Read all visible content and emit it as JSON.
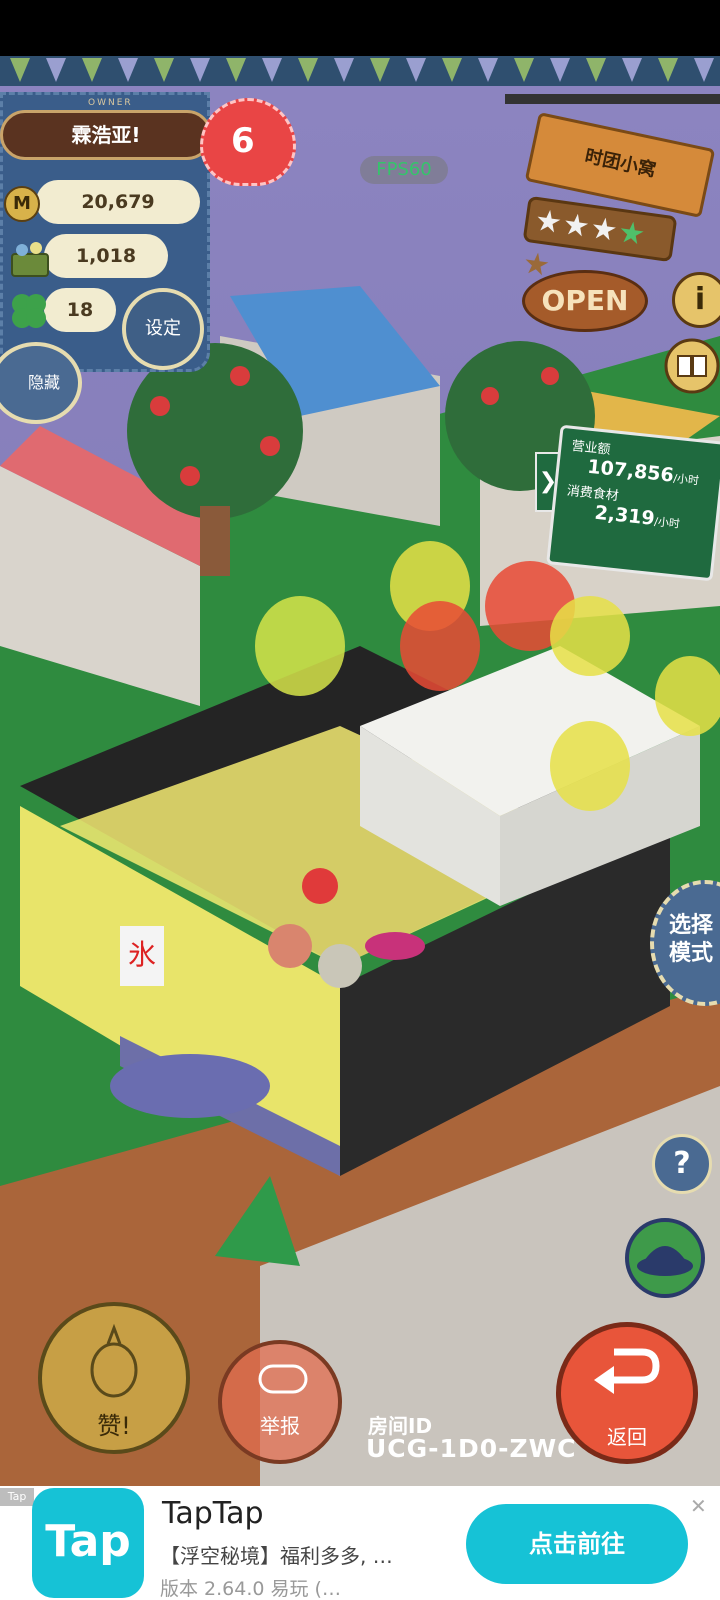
{
  "owner": {
    "tag": "OWNER",
    "name": "霖浩亚!",
    "coins": "20,679",
    "food": "1,018",
    "clovers": "18",
    "level": "6",
    "coin_glyph": "M"
  },
  "buttons": {
    "settings": "设定",
    "hide": "隐藏",
    "like": "赞!",
    "report": "举报",
    "back": "返回",
    "select_mode": "选择模式",
    "help": "?",
    "info": "i"
  },
  "fps": "FPS60",
  "shop": {
    "name": "时团小窝",
    "stars_filled": 4,
    "stars_total": 5,
    "status": "OPEN"
  },
  "stats": {
    "revenue_label": "营业额",
    "revenue_value": "107,856",
    "revenue_unit": "/小时",
    "food_label": "消费食材",
    "food_value": "2,319",
    "food_unit": "/小时"
  },
  "room": {
    "label": "房间ID",
    "id": "UCG-1D0-ZWC"
  },
  "ad": {
    "tag": "Tap",
    "icon_text": "Tap",
    "title": "TapTap",
    "subtitle": "【浮空秘境】福利多多, …",
    "version": "版本 2.64.0  易玩 (…",
    "cta": "点击前往",
    "close": "✕"
  },
  "colors": {
    "sky": "#7f74b6",
    "grass": "#2d8a3e",
    "panel": "#3a5d8a",
    "accent": "#16c2d6",
    "heart": "#e94545",
    "back_btn": "#e8553a"
  }
}
